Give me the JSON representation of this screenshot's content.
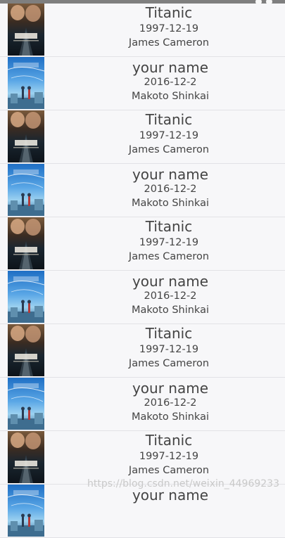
{
  "movies": [
    {
      "title": "Titanic",
      "date": "1997-12-19",
      "director": "James Cameron",
      "poster": "titanic-poster"
    },
    {
      "title": "your name",
      "date": "2016-12-2",
      "director": "Makoto Shinkai",
      "poster": "your-name-poster"
    },
    {
      "title": "Titanic",
      "date": "1997-12-19",
      "director": "James Cameron",
      "poster": "titanic-poster"
    },
    {
      "title": "your name",
      "date": "2016-12-2",
      "director": "Makoto Shinkai",
      "poster": "your-name-poster"
    },
    {
      "title": "Titanic",
      "date": "1997-12-19",
      "director": "James Cameron",
      "poster": "titanic-poster"
    },
    {
      "title": "your name",
      "date": "2016-12-2",
      "director": "Makoto Shinkai",
      "poster": "your-name-poster"
    },
    {
      "title": "Titanic",
      "date": "1997-12-19",
      "director": "James Cameron",
      "poster": "titanic-poster"
    },
    {
      "title": "your name",
      "date": "2016-12-2",
      "director": "Makoto Shinkai",
      "poster": "your-name-poster"
    },
    {
      "title": "Titanic",
      "date": "1997-12-19",
      "director": "James Cameron",
      "poster": "titanic-poster"
    },
    {
      "title": "your name",
      "date": "",
      "director": "",
      "poster": "your-name-poster"
    }
  ],
  "watermark": "https://blog.csdn.net/weixin_44969233"
}
